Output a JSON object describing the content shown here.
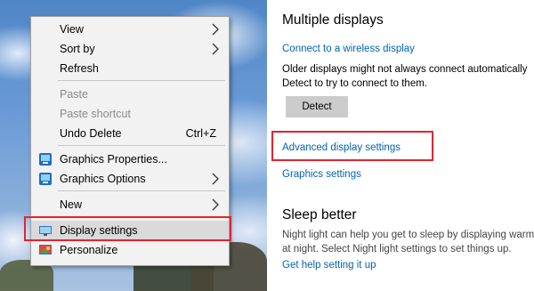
{
  "context_menu": {
    "items": [
      {
        "label": "View"
      },
      {
        "label": "Sort by"
      },
      {
        "label": "Refresh"
      },
      {
        "label": "Paste"
      },
      {
        "label": "Paste shortcut"
      },
      {
        "label": "Undo Delete",
        "shortcut": "Ctrl+Z"
      },
      {
        "label": "Graphics Properties..."
      },
      {
        "label": "Graphics Options"
      },
      {
        "label": "New"
      },
      {
        "label": "Display settings"
      },
      {
        "label": "Personalize"
      }
    ]
  },
  "settings": {
    "multiple_displays_heading": "Multiple displays",
    "connect_link": "Connect to a wireless display",
    "older_displays_line1": "Older displays might not always connect automatically",
    "older_displays_line2": "Detect to try to connect to them.",
    "detect_button": "Detect",
    "advanced_link": "Advanced display settings",
    "graphics_link": "Graphics settings",
    "sleep_heading": "Sleep better",
    "sleep_line1": "Night light can help you get to sleep by displaying warm",
    "sleep_line2": "at night. Select Night light settings to set things up.",
    "help_link": "Get help setting it up"
  },
  "colors": {
    "highlight_box": "#e0242f",
    "link": "#0063b1"
  }
}
